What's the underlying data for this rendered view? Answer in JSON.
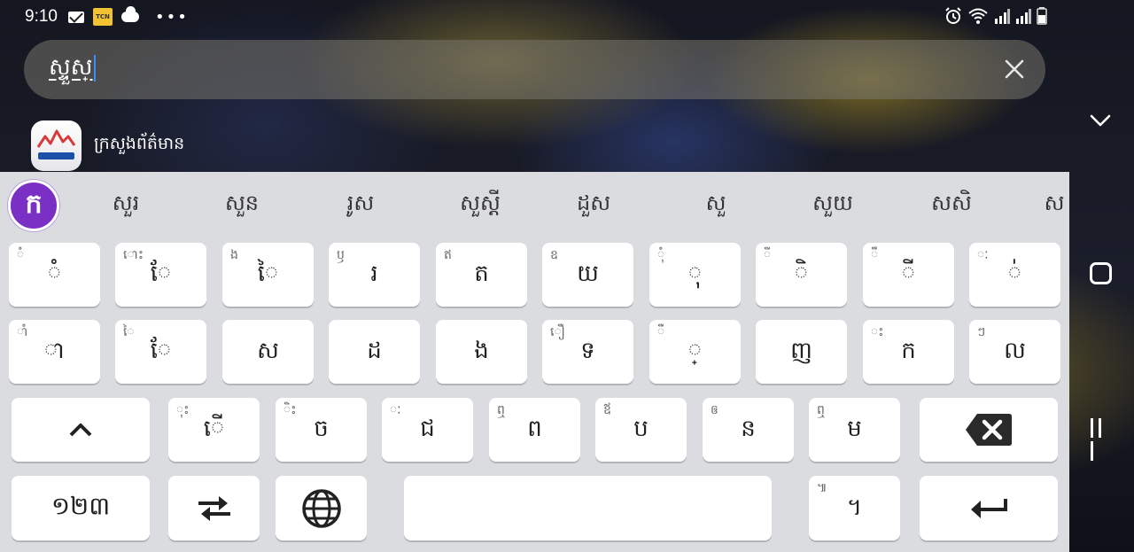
{
  "status_bar": {
    "time": "9:10",
    "tcn_label": "TCN",
    "icons_left": [
      "mail-icon",
      "tcn-icon",
      "cloud-icon",
      "more-icon"
    ],
    "icons_right": [
      "alarm-icon",
      "wifi-icon",
      "signal-icon",
      "signal-icon",
      "battery-icon"
    ]
  },
  "search": {
    "value": "ស្ទួស្",
    "clear_icon": "close-icon",
    "collapse_icon": "chevron-down-icon"
  },
  "results": [
    {
      "label": "ក្រសួងព័ត៌មាន",
      "icon": "app-icon"
    }
  ],
  "keyboard": {
    "logo": "ក",
    "suggestions": [
      "សួរ",
      "សួន",
      "រូស",
      "សួស្តី",
      "ដួស",
      "សួ",
      "សួយ",
      "សសិ",
      "ស"
    ],
    "row1": [
      {
        "main": "ំ",
        "sub": "ំ"
      },
      {
        "main": "ែ",
        "sub": "ោះ"
      },
      {
        "main": "ៃ",
        "sub": "ង"
      },
      {
        "main": "រ",
        "sub": "ឫ"
      },
      {
        "main": "ត",
        "sub": "ឥ"
      },
      {
        "main": "យ",
        "sub": "ឧ"
      },
      {
        "main": "ុ",
        "sub": "ុំ"
      },
      {
        "main": "ិ",
        "sub": "ី"
      },
      {
        "main": "ី",
        "sub": "ឹ"
      },
      {
        "main": "់",
        "sub": "ៈ"
      }
    ],
    "row2": [
      {
        "main": "ា",
        "sub": "ាំ"
      },
      {
        "main": "ែ",
        "sub": "ៃ"
      },
      {
        "main": "ស",
        "sub": ""
      },
      {
        "main": "ដ",
        "sub": ""
      },
      {
        "main": "ង",
        "sub": ""
      },
      {
        "main": "ទ",
        "sub": "ឿ"
      },
      {
        "main": "្",
        "sub": "ឺ"
      },
      {
        "main": "ញ",
        "sub": ""
      },
      {
        "main": "ក",
        "sub": "ះ"
      },
      {
        "main": "ល",
        "sub": "ៗ"
      }
    ],
    "row3": [
      {
        "main": "ើ",
        "sub": "ុះ"
      },
      {
        "main": "ច",
        "sub": "ិះ"
      },
      {
        "main": "ជ",
        "sub": "ៈ"
      },
      {
        "main": "ព",
        "sub": "ឮ"
      },
      {
        "main": "ប",
        "sub": "ឪ"
      },
      {
        "main": "ន",
        "sub": "ឲ"
      },
      {
        "main": "ម",
        "sub": "ឮ"
      }
    ],
    "shift_icon": "chevron-up-icon",
    "backspace_icon": "backspace-icon",
    "numbers_label": "១២៣",
    "swap_icon": "swap-icon",
    "globe_icon": "globe-icon",
    "period_main": "។",
    "period_sub": "៕",
    "enter_icon": "enter-icon"
  },
  "nav": {
    "icons": [
      "home-icon",
      "recents-icon"
    ]
  }
}
